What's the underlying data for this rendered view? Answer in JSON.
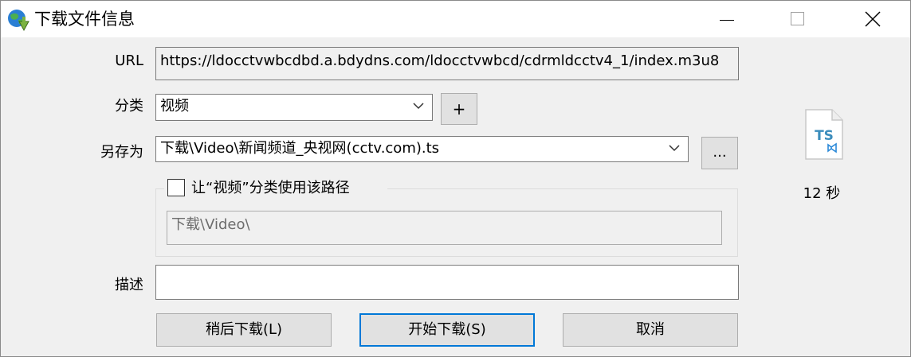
{
  "window": {
    "title": "下载文件信息"
  },
  "form": {
    "url_label": "URL",
    "url_value": "https://ldocctvwbcdbd.a.bdydns.com/ldocctvwbcd/cdrmldcctv4_1/index.m3u8",
    "category_label": "分类",
    "category_value": "视频",
    "add_category_label": "+",
    "saveas_label": "另存为",
    "saveas_value": "下载\\Video\\新闻频道_央视网(cctv.com).ts",
    "browse_label": "...",
    "use_path_label": "让“视频”分类使用该路径",
    "use_path_checked": false,
    "category_path_value": "下载\\Video\\",
    "description_label": "描述",
    "description_value": ""
  },
  "file_info": {
    "icon_name": "ts-file-icon",
    "icon_text": "TS",
    "duration": "12 秒"
  },
  "buttons": {
    "later": "稍后下载(L)",
    "start": "开始下载(S)",
    "cancel": "取消"
  },
  "colors": {
    "accent": "#0078d7",
    "ts_icon_text": "#3c8dbc"
  }
}
